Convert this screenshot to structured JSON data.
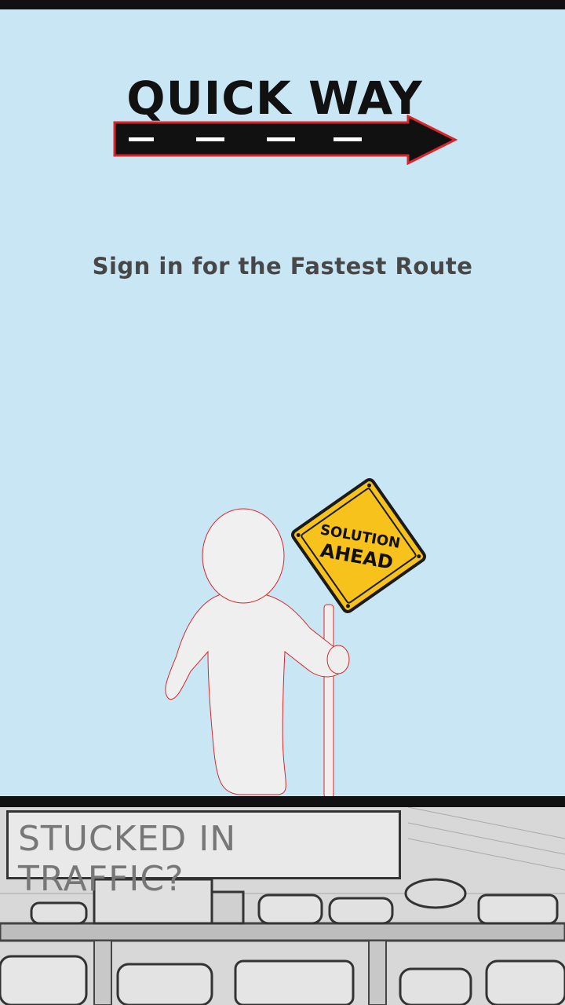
{
  "app": {
    "title": "QUICK WAY",
    "subtitle": "Sign in for the Fastest Route"
  },
  "mascot_sign": {
    "line1": "SOLUTION",
    "line2": "AHEAD"
  },
  "banner": {
    "caption": "STUCKED IN TRAFFIC?"
  },
  "colors": {
    "background": "#c9e6f4",
    "sign_yellow": "#f6c21b",
    "arrow_outline": "#d9262a",
    "subtitle_text": "#474747"
  }
}
